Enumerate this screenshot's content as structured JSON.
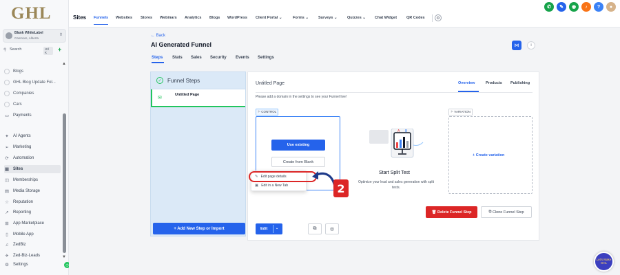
{
  "brand": {
    "logo": "GHL"
  },
  "account": {
    "name": "Blank WhiteLabel",
    "location": "Canmore, Alberta"
  },
  "search": {
    "label": "Search",
    "shortcut": "ctrl K"
  },
  "sidebar": {
    "items": [
      {
        "label": "Blogs",
        "icon": "circle-icon"
      },
      {
        "label": "GHL Blog Update Fol...",
        "icon": "circle-icon"
      },
      {
        "label": "Companies",
        "icon": "circle-icon"
      },
      {
        "label": "Cars",
        "icon": "circle-icon"
      },
      {
        "label": "Payments",
        "icon": "card-icon"
      },
      {
        "label": "AI Agents",
        "icon": "sparkle-icon"
      },
      {
        "label": "Marketing",
        "icon": "send-icon"
      },
      {
        "label": "Automation",
        "icon": "automation-icon"
      },
      {
        "label": "Sites",
        "icon": "sites-icon"
      },
      {
        "label": "Memberships",
        "icon": "memberships-icon"
      },
      {
        "label": "Media Storage",
        "icon": "media-icon"
      },
      {
        "label": "Reputation",
        "icon": "star-icon"
      },
      {
        "label": "Reporting",
        "icon": "chart-icon"
      },
      {
        "label": "App Marketplace",
        "icon": "grid-icon"
      },
      {
        "label": "Mobile App",
        "icon": "mobile-icon"
      },
      {
        "label": "ZedBiz",
        "icon": "bell-icon"
      },
      {
        "label": "Zed-Biz-Leads",
        "icon": "rocket-icon"
      },
      {
        "label": "Settings",
        "icon": "gear-icon"
      }
    ],
    "active": "Sites"
  },
  "topnav": {
    "title": "Sites",
    "tabs": [
      "Funnels",
      "Websites",
      "Stores",
      "Webinars",
      "Analytics",
      "Blogs",
      "WordPress",
      "Client Portal ⌄",
      "Forms ⌄",
      "Surveys ⌄",
      "Quizzes ⌄",
      "Chat Widget",
      "QR Codes"
    ],
    "active": "Funnels"
  },
  "page": {
    "back": "← Back",
    "funnel_title": "AI Generated Funnel",
    "tabs": [
      "Steps",
      "Stats",
      "Sales",
      "Security",
      "Events",
      "Settings"
    ],
    "active_tab": "Steps"
  },
  "steps": {
    "header": "Funnel Steps",
    "items": [
      {
        "name": "Untitled Page"
      }
    ],
    "add_button": "+ Add New Step or Import"
  },
  "detail": {
    "page_title": "Untitled Page",
    "tabs": [
      "Overview",
      "Products",
      "Publishing"
    ],
    "active_tab": "Overview",
    "note": "Please add a domain in the settings to see your Funnel live!",
    "control_label": "CONTROL",
    "variation_label": "VARIATION",
    "use_existing": "Use existing",
    "create_blank": "Create from Blank",
    "dropdown": [
      "Edit page details",
      "Edit in a New Tab"
    ],
    "edit": "Edit",
    "split_title": "Start Split Test",
    "split_desc": "Optimize your lead and sales generation with split tests.",
    "create_variation": "+ Create variation",
    "delete": "Delete Funnel Step",
    "clone": "Clone Funnel Step",
    "annotation_number": "2"
  },
  "chat": {
    "label": "Let's Make GHL"
  },
  "colors": {
    "accent": "#2563eb",
    "success": "#22c55e",
    "danger": "#dc2626",
    "logo": "#9b8758"
  }
}
